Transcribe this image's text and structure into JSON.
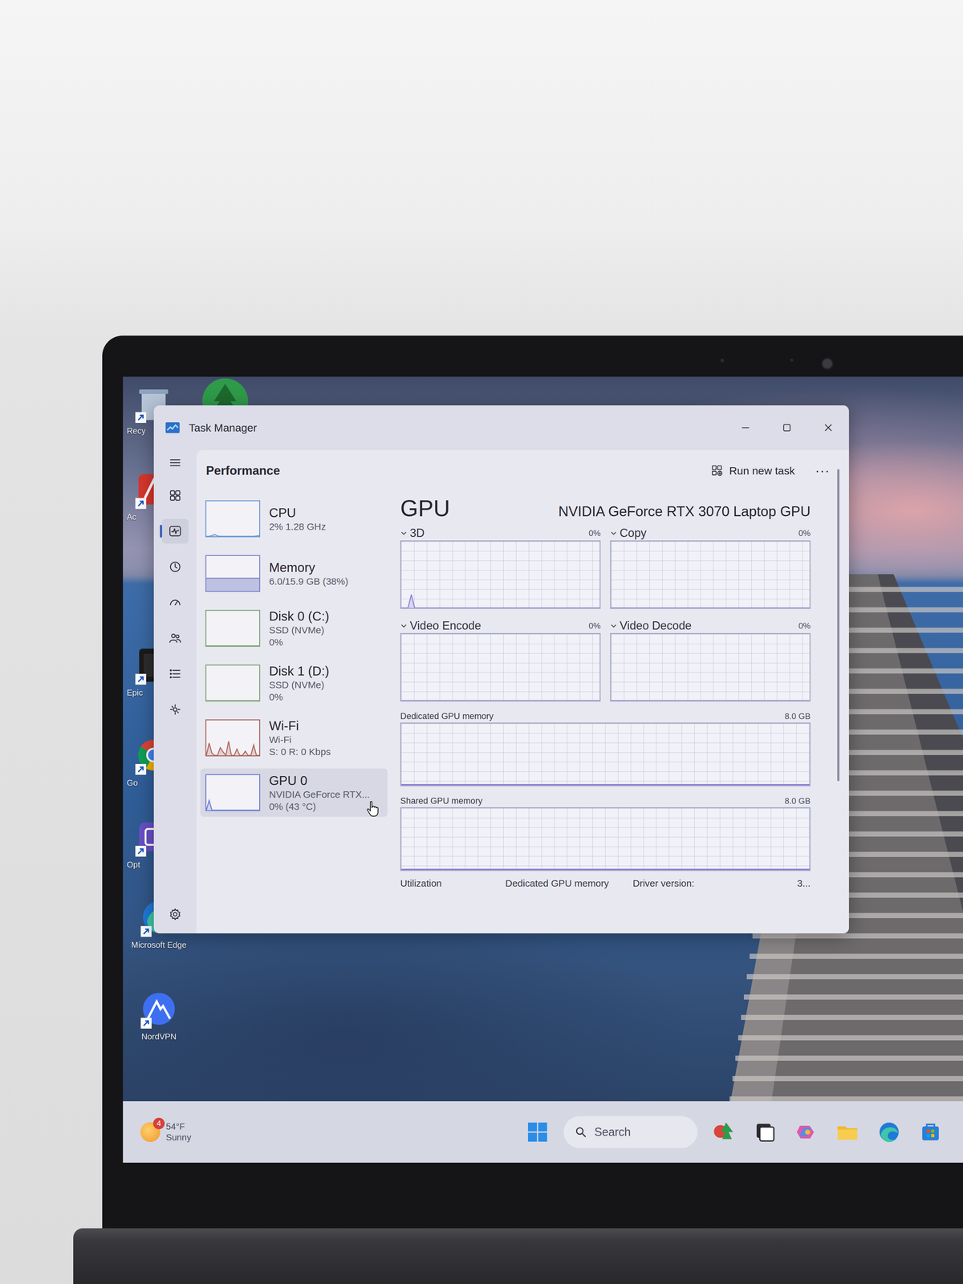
{
  "window": {
    "title": "Task Manager"
  },
  "nav": [
    {
      "selected": false
    },
    {
      "selected": true
    },
    {
      "selected": false
    },
    {
      "selected": false
    },
    {
      "selected": false
    },
    {
      "selected": false
    },
    {
      "selected": false
    }
  ],
  "header": {
    "title": "Performance",
    "run_task": "Run new task",
    "more": "···"
  },
  "devices": [
    {
      "name": "CPU",
      "lines": [
        "2% 1.28 GHz"
      ],
      "selected": false,
      "kind": "line",
      "color": "#6f9bd6",
      "values": [
        0,
        0,
        2,
        5,
        1,
        0,
        0,
        0,
        0,
        0,
        0,
        0,
        0,
        0,
        0,
        0,
        0,
        0,
        1,
        2
      ]
    },
    {
      "name": "Memory",
      "lines": [
        "6.0/15.9 GB (38%)"
      ],
      "selected": false,
      "kind": "fill",
      "color": "#7f86c8",
      "level": 0.38
    },
    {
      "name": "Disk 0 (C:)",
      "lines": [
        "SSD (NVMe)",
        "0%"
      ],
      "selected": false,
      "kind": "line",
      "color": "#7fa876",
      "values": [
        0,
        0,
        0,
        0,
        0,
        0,
        0,
        0,
        0,
        0,
        0,
        0,
        0,
        0,
        0,
        0,
        0,
        0,
        0,
        0
      ]
    },
    {
      "name": "Disk 1 (D:)",
      "lines": [
        "SSD (NVMe)",
        "0%"
      ],
      "selected": false,
      "kind": "line",
      "color": "#7fa876",
      "values": [
        0,
        0,
        0,
        0,
        0,
        0,
        0,
        0,
        0,
        0,
        0,
        0,
        0,
        0,
        0,
        0,
        0,
        0,
        0,
        0
      ]
    },
    {
      "name": "Wi-Fi",
      "lines": [
        "Wi-Fi",
        "S: 0 R: 0 Kbps"
      ],
      "selected": false,
      "kind": "line",
      "color": "#b0665a",
      "values": [
        0,
        35,
        6,
        0,
        0,
        22,
        10,
        0,
        40,
        0,
        0,
        18,
        0,
        0,
        12,
        0,
        0,
        30,
        0,
        0
      ]
    },
    {
      "name": "GPU 0",
      "lines": [
        "NVIDIA GeForce RTX...",
        "0% (43 °C)"
      ],
      "selected": true,
      "kind": "line",
      "color": "#6f7fd0",
      "values": [
        0,
        28,
        0,
        0,
        0,
        0,
        0,
        0,
        0,
        0,
        0,
        0,
        0,
        0,
        0,
        0,
        0,
        0,
        0,
        0
      ]
    }
  ],
  "gpu": {
    "title": "GPU",
    "model": "NVIDIA GeForce RTX 3070 Laptop GPU",
    "engines": [
      {
        "label": "3D",
        "reading": "0%",
        "values": [
          0,
          0,
          0,
          20,
          0,
          0,
          0,
          0,
          0,
          0,
          0,
          0,
          0,
          0,
          0,
          0,
          0,
          0,
          0,
          0,
          0,
          0,
          0,
          0,
          0,
          0,
          0,
          0,
          0,
          0,
          0,
          0,
          0,
          0,
          0,
          0,
          0,
          0,
          0,
          0,
          0,
          0,
          0,
          0,
          0,
          0,
          0,
          0,
          0,
          0,
          0,
          0,
          0,
          0,
          0,
          0,
          0,
          0,
          0,
          0
        ]
      },
      {
        "label": "Copy",
        "reading": "0%",
        "values": [
          0,
          0,
          0,
          0,
          0,
          0,
          0,
          0,
          0,
          0,
          0,
          0,
          0,
          0,
          0,
          0,
          0,
          0,
          0,
          0
        ]
      },
      {
        "label": "Video Encode",
        "reading": "0%",
        "values": [
          0,
          0,
          0,
          0,
          0,
          0,
          0,
          0,
          0,
          0,
          0,
          0,
          0,
          0,
          0,
          0,
          0,
          0,
          0,
          0
        ]
      },
      {
        "label": "Video Decode",
        "reading": "0%",
        "values": [
          0,
          0,
          0,
          0,
          0,
          0,
          0,
          0,
          0,
          0,
          0,
          0,
          0,
          0,
          0,
          0,
          0,
          0,
          0,
          0
        ]
      }
    ],
    "memory": [
      {
        "label": "Dedicated GPU memory",
        "max": "8.0 GB",
        "level": 0.02
      },
      {
        "label": "Shared GPU memory",
        "max": "8.0 GB",
        "level": 0
      }
    ]
  },
  "stats": [
    "Utilization",
    "Dedicated GPU memory",
    "Driver version:",
    "3..."
  ],
  "desktop": {
    "icons": [
      {
        "label": "Recy"
      },
      {
        "label": "Ac"
      },
      {
        "label": "Epic"
      },
      {
        "label": "Go"
      },
      {
        "label": "Opt"
      },
      {
        "label": "Microsoft Edge"
      },
      {
        "label": "NordVPN"
      }
    ]
  },
  "taskbar": {
    "weather": {
      "badge": "4",
      "temp": "54°F",
      "condition": "Sunny"
    },
    "search": {
      "placeholder": "Search"
    }
  }
}
